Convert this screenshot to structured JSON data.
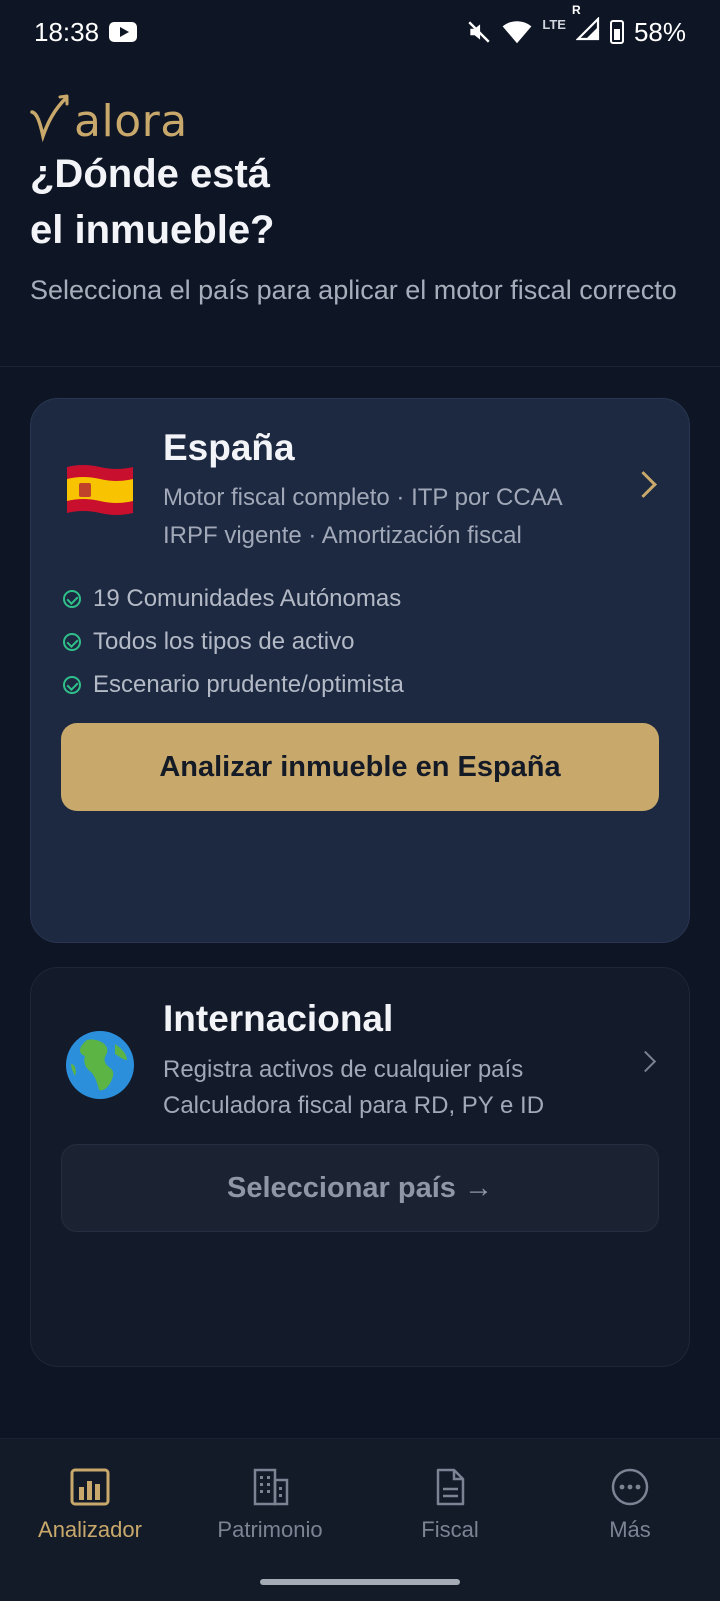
{
  "status_bar": {
    "time": "18:38",
    "network": "LTE",
    "roaming": "R",
    "battery": "58%"
  },
  "header": {
    "logo_text": "alora",
    "title": "¿Dónde está\nel inmueble?",
    "subtitle": "Selecciona el país para aplicar el motor fiscal correcto"
  },
  "cards": [
    {
      "title": "España",
      "description_lines": [
        "Motor fiscal completo · ITP por CCAA",
        "IRPF vigente · Amortización fiscal"
      ],
      "features": [
        "19 Comunidades Autónomas",
        "Todos los tipos de activo",
        "Escenario prudente/optimista"
      ],
      "button_label": "Analizar inmueble en España"
    },
    {
      "title": "Internacional",
      "description_lines": [
        "Registra activos de cualquier país",
        "Calculadora fiscal para RD, PY e ID"
      ],
      "button_label": "Seleccionar país →"
    }
  ],
  "bottom_nav": [
    {
      "label": "Analizador",
      "icon": "bar-chart-icon",
      "active": true
    },
    {
      "label": "Patrimonio",
      "icon": "building-icon",
      "active": false
    },
    {
      "label": "Fiscal",
      "icon": "document-icon",
      "active": false
    },
    {
      "label": "Más",
      "icon": "more-icon",
      "active": false
    }
  ],
  "colors": {
    "background": "#0e1524",
    "accent_gold": "#c9a96b",
    "check_green": "#2fc08a",
    "card_spain": "#1d2841",
    "card_international": "#131b2a"
  }
}
